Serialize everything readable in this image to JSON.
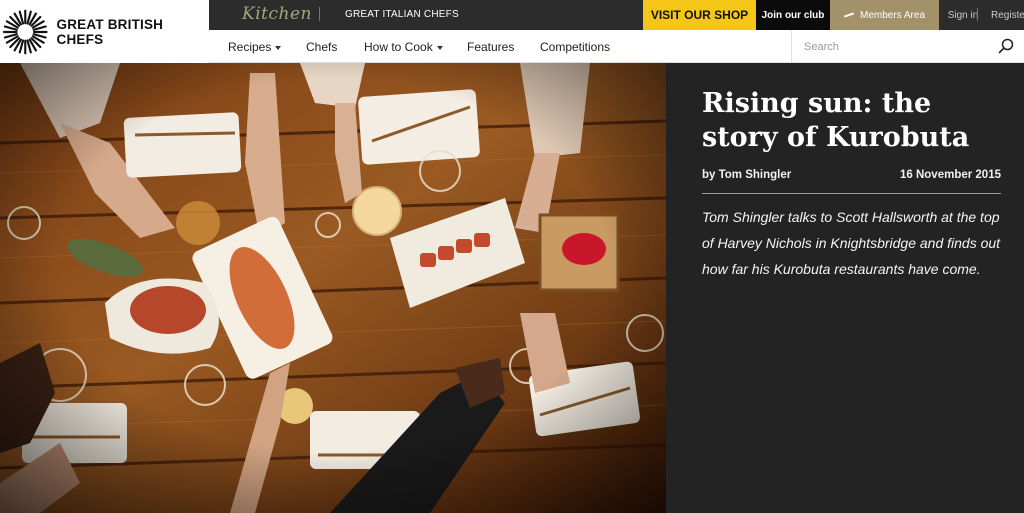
{
  "brand": {
    "logo_text": "GREAT BRITISH CHEFS"
  },
  "topbar": {
    "kitchen_label": "Kitchen",
    "italian_link": "GREAT ITALIAN CHEFS",
    "shop_label": "VISIT OUR SHOP",
    "club_label": "Join our club",
    "members_label": "Members Area",
    "signin_label": "Sign in",
    "register_label": "Register",
    "colors": {
      "shop": "#f3c617",
      "members": "#a3916a",
      "bar": "#2c2c2c"
    }
  },
  "nav": {
    "items": [
      {
        "label": "Recipes",
        "dropdown": true
      },
      {
        "label": "Chefs",
        "dropdown": false
      },
      {
        "label": "How to Cook",
        "dropdown": true
      },
      {
        "label": "Features",
        "dropdown": false
      },
      {
        "label": "Competitions",
        "dropdown": false
      }
    ],
    "search_placeholder": "Search",
    "search_value": ""
  },
  "hero": {
    "image_icon": "restaurant-table-photo",
    "title": "Rising sun: the story of Kurobuta",
    "byline": "by Tom Shingler",
    "date": "16 November 2015",
    "standfirst": "Tom Shingler talks to Scott Hallsworth at the top of Harvey Nichols in Knightsbridge and finds out how far his Kurobuta restaurants have come."
  }
}
